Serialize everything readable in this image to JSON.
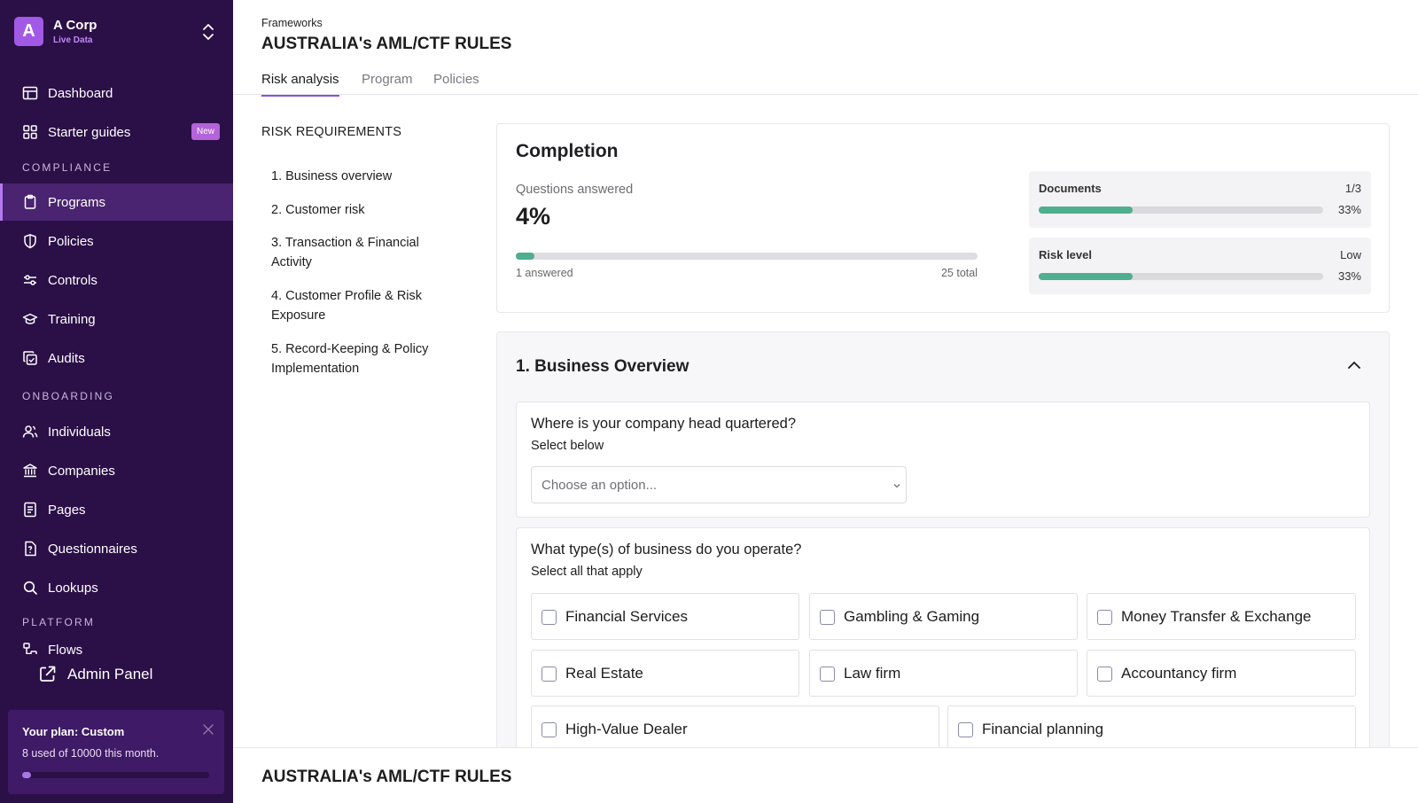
{
  "org": {
    "initial": "A",
    "name": "A Corp",
    "subtitle": "Live Data"
  },
  "sidebar": {
    "items": [
      {
        "label": "Dashboard",
        "icon": "dashboard-icon"
      },
      {
        "label": "Starter guides",
        "icon": "grid-icon",
        "badge": "New"
      },
      {
        "label": "Programs",
        "icon": "clipboard-icon",
        "active": true
      },
      {
        "label": "Policies",
        "icon": "shield-icon"
      },
      {
        "label": "Controls",
        "icon": "sliders-icon"
      },
      {
        "label": "Training",
        "icon": "graduation-cap-icon"
      },
      {
        "label": "Audits",
        "icon": "copy-check-icon"
      },
      {
        "label": "Individuals",
        "icon": "users-icon"
      },
      {
        "label": "Companies",
        "icon": "bank-icon"
      },
      {
        "label": "Pages",
        "icon": "file-text-icon"
      },
      {
        "label": "Questionnaires",
        "icon": "file-question-icon"
      },
      {
        "label": "Lookups",
        "icon": "search-icon"
      },
      {
        "label": "Flows",
        "icon": "flow-icon"
      }
    ],
    "sections": {
      "compliance": "COMPLIANCE",
      "onboarding": "ONBOARDING",
      "platform": "PLATFORM"
    },
    "admin_label": "Admin Panel"
  },
  "plan": {
    "title": "Your plan: Custom",
    "usage": "8 used of 10000 this month.",
    "used": 8,
    "limit": 10000
  },
  "header": {
    "breadcrumb": "Frameworks",
    "title": "AUSTRALIA's AML/CTF RULES",
    "tabs": [
      {
        "label": "Risk analysis"
      },
      {
        "label": "Program"
      },
      {
        "label": "Policies"
      }
    ]
  },
  "requirements": {
    "heading": "RISK REQUIREMENTS",
    "items": [
      "1. Business overview",
      "2. Customer risk",
      "3. Transaction & Financial Activity",
      "4. Customer Profile & Risk Exposure",
      "5. Record-Keeping & Policy Implementation"
    ]
  },
  "completion": {
    "title": "Completion",
    "questions_label": "Questions answered",
    "percent_text": "4%",
    "progress": 0.04,
    "answered_text": "1 answered",
    "total_text": "25 total",
    "documents": {
      "label": "Documents",
      "value": "1/3",
      "percent_text": "33%",
      "progress": 0.33
    },
    "risk": {
      "label": "Risk level",
      "value": "Low",
      "percent_text": "33%",
      "progress": 0.33
    }
  },
  "section": {
    "title": "1. Business Overview",
    "q1": {
      "text": "Where is your company head quartered?",
      "sub": "Select below",
      "placeholder": "Choose an option..."
    },
    "q2": {
      "text": "What type(s) of business do you operate?",
      "sub": "Select all that apply",
      "options": [
        "Financial Services",
        "Gambling & Gaming",
        "Money Transfer & Exchange",
        "Real Estate",
        "Law firm",
        "Accountancy firm",
        "High-Value Dealer",
        "Financial planning"
      ]
    }
  },
  "footer": {
    "title": "AUSTRALIA's AML/CTF RULES"
  },
  "colors": {
    "sidebar": "#2b0f47",
    "accent": "#8b4fd6",
    "progress": "#4fae8d"
  }
}
